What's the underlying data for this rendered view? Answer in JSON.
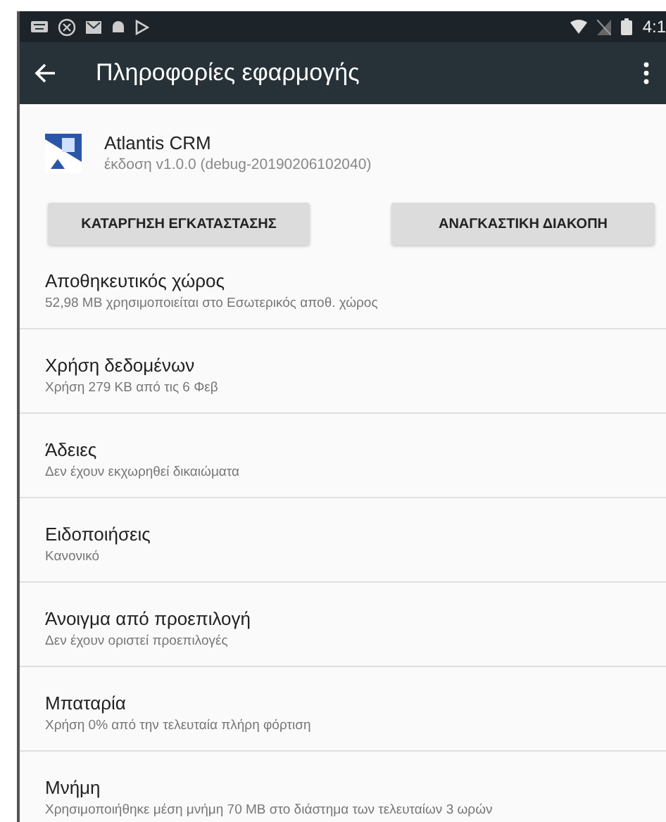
{
  "status_bar": {
    "time": "4:1"
  },
  "toolbar": {
    "title": "Πληροφορίες εφαρμογής"
  },
  "app": {
    "name": "Atlantis CRM",
    "version": "έκδοση v1.0.0 (debug-20190206102040)"
  },
  "buttons": [
    "ΚΑΤΑΡΓΗΣΗ ΕΓΚΑΤΑΣΤΑΣΗΣ",
    "ΑΝΑΓΚΑΣΤΙΚΗ ΔΙΑΚΟΠΗ"
  ],
  "settings": [
    {
      "title": "Αποθηκευτικός χώρος",
      "summary": "52,98 MB χρησιμοποιείται στο Εσωτερικός αποθ. χώρος"
    },
    {
      "title": "Χρήση δεδομένων",
      "summary": "Χρήση 279 KB από τις 6 Φεβ"
    },
    {
      "title": "Άδειες",
      "summary": "Δεν έχουν εκχωρηθεί δικαιώματα"
    },
    {
      "title": "Ειδοποιήσεις",
      "summary": "Κανονικό"
    },
    {
      "title": "Άνοιγμα από προεπιλογή",
      "summary": "Δεν έχουν οριστεί προεπιλογές"
    },
    {
      "title": "Μπαταρία",
      "summary": "Χρήση 0% από την τελευταία πλήρη φόρτιση"
    },
    {
      "title": "Μνήμη",
      "summary": "Χρησιμοποιήθηκε μέση μνήμη 70 MB στο διάστημα των τελευταίων 3 ωρών"
    }
  ]
}
